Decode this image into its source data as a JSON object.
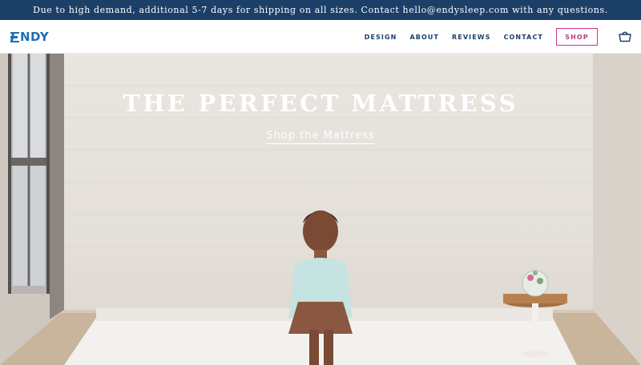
{
  "announcement": {
    "text": "Due to high demand, additional 5-7 days for shipping on all sizes. Contact hello@endysleep.com with any questions."
  },
  "header": {
    "logo_text": "NDY",
    "nav": [
      {
        "label": "DESIGN"
      },
      {
        "label": "ABOUT"
      },
      {
        "label": "REVIEWS"
      },
      {
        "label": "CONTACT"
      }
    ],
    "shop_label": "SHOP",
    "cart_icon": "shopping-bag-icon"
  },
  "hero": {
    "title": "THE PERFECT MATTRESS",
    "cta_label": "Shop the Mattress"
  },
  "colors": {
    "announcement_bg": "#1c3f68",
    "brand_blue": "#1e6fb3",
    "nav_text": "#1c3f68",
    "shop_accent": "#c63a7f"
  }
}
